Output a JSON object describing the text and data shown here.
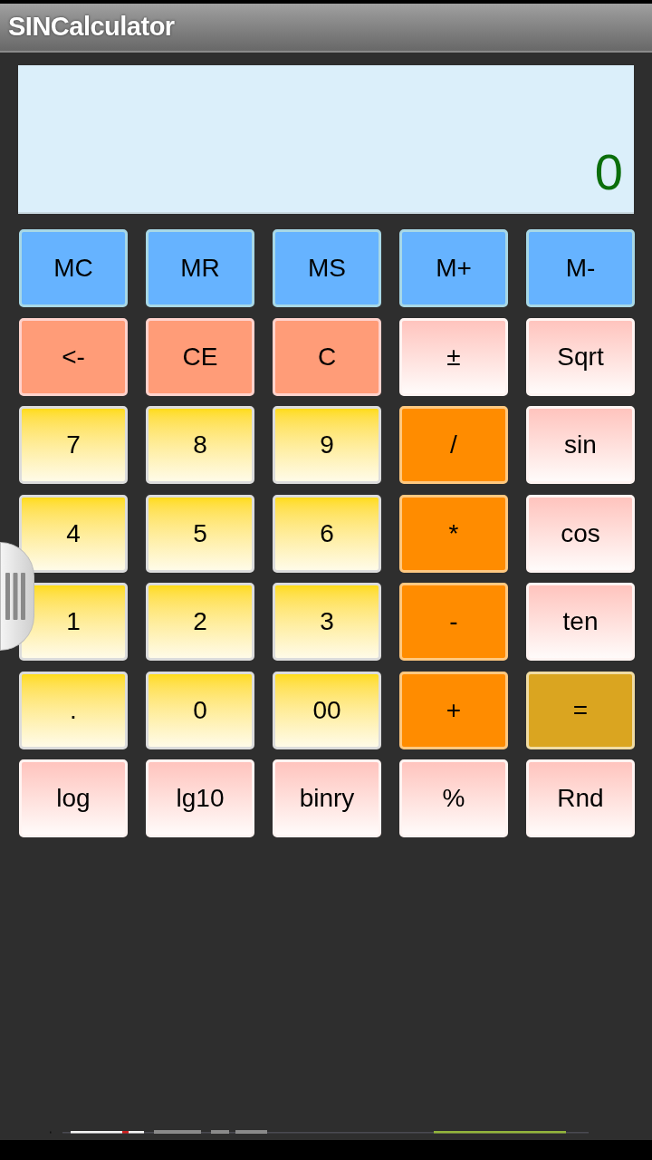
{
  "window": {
    "title": "SINCalculator"
  },
  "display": {
    "value": "0"
  },
  "keys": [
    {
      "label": "MC",
      "kind": "memory"
    },
    {
      "label": "MR",
      "kind": "memory"
    },
    {
      "label": "MS",
      "kind": "memory"
    },
    {
      "label": "M+",
      "kind": "memory"
    },
    {
      "label": "M-",
      "kind": "memory"
    },
    {
      "label": "<-",
      "kind": "clear"
    },
    {
      "label": "CE",
      "kind": "clear"
    },
    {
      "label": "C",
      "kind": "clear"
    },
    {
      "label": "±",
      "kind": "function"
    },
    {
      "label": "Sqrt",
      "kind": "function"
    },
    {
      "label": "7",
      "kind": "digit"
    },
    {
      "label": "8",
      "kind": "digit"
    },
    {
      "label": "9",
      "kind": "digit"
    },
    {
      "label": "/",
      "kind": "operator"
    },
    {
      "label": "sin",
      "kind": "function"
    },
    {
      "label": "4",
      "kind": "digit"
    },
    {
      "label": "5",
      "kind": "digit"
    },
    {
      "label": "6",
      "kind": "digit"
    },
    {
      "label": "*",
      "kind": "operator"
    },
    {
      "label": "cos",
      "kind": "function"
    },
    {
      "label": "1",
      "kind": "digit"
    },
    {
      "label": "2",
      "kind": "digit"
    },
    {
      "label": "3",
      "kind": "digit"
    },
    {
      "label": "-",
      "kind": "operator"
    },
    {
      "label": "ten",
      "kind": "function"
    },
    {
      "label": ".",
      "kind": "digit"
    },
    {
      "label": "0",
      "kind": "digit"
    },
    {
      "label": "00",
      "kind": "digit"
    },
    {
      "label": "+",
      "kind": "operator"
    },
    {
      "label": "=",
      "kind": "equals"
    },
    {
      "label": "log",
      "kind": "function"
    },
    {
      "label": "lg10",
      "kind": "function"
    },
    {
      "label": "binry",
      "kind": "function"
    },
    {
      "label": "%",
      "kind": "function"
    },
    {
      "label": "Rnd",
      "kind": "function"
    }
  ]
}
